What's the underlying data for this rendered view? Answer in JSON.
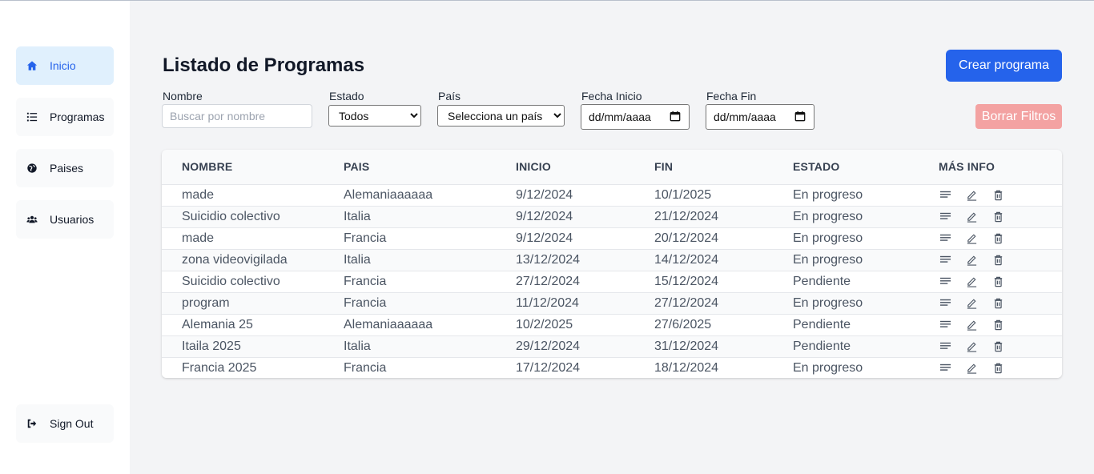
{
  "sidebar": {
    "items": [
      {
        "label": "Inicio",
        "icon": "home-icon",
        "active": true
      },
      {
        "label": "Programas",
        "icon": "list-icon",
        "active": false
      },
      {
        "label": "Paises",
        "icon": "globe-icon",
        "active": false
      },
      {
        "label": "Usuarios",
        "icon": "users-icon",
        "active": false
      }
    ],
    "signout_label": "Sign Out"
  },
  "header": {
    "title": "Listado de Programas",
    "create_label": "Crear programa",
    "clear_label": "Borrar Filtros"
  },
  "filters": {
    "nombre_label": "Nombre",
    "nombre_placeholder": "Buscar por nombre",
    "estado_label": "Estado",
    "estado_value": "Todos",
    "pais_label": "País",
    "pais_value": "Selecciona un país",
    "fecha_inicio_label": "Fecha Inicio",
    "fecha_inicio_value": "dd/mm/aaaa",
    "fecha_fin_label": "Fecha Fin",
    "fecha_fin_value": "dd/mm/aaaa"
  },
  "table": {
    "columns": [
      "NOMBRE",
      "PAIS",
      "INICIO",
      "FIN",
      "ESTADO",
      "MÁS INFO"
    ],
    "rows": [
      {
        "nombre": "made",
        "pais": "Alemaniaaaaaa",
        "inicio": "9/12/2024",
        "fin": "10/1/2025",
        "estado": "En progreso"
      },
      {
        "nombre": "Suicidio colectivo",
        "pais": "Italia",
        "inicio": "9/12/2024",
        "fin": "21/12/2024",
        "estado": "En progreso"
      },
      {
        "nombre": "made",
        "pais": "Francia",
        "inicio": "9/12/2024",
        "fin": "20/12/2024",
        "estado": "En progreso"
      },
      {
        "nombre": "zona videovigilada",
        "pais": "Italia",
        "inicio": "13/12/2024",
        "fin": "14/12/2024",
        "estado": "En progreso"
      },
      {
        "nombre": "Suicidio colectivo",
        "pais": "Francia",
        "inicio": "27/12/2024",
        "fin": "15/12/2024",
        "estado": "Pendiente"
      },
      {
        "nombre": "program",
        "pais": "Francia",
        "inicio": "11/12/2024",
        "fin": "27/12/2024",
        "estado": "En progreso"
      },
      {
        "nombre": "Alemania 25",
        "pais": "Alemaniaaaaaa",
        "inicio": "10/2/2025",
        "fin": "27/6/2025",
        "estado": "Pendiente"
      },
      {
        "nombre": "Itaila 2025",
        "pais": "Italia",
        "inicio": "29/12/2024",
        "fin": "31/12/2024",
        "estado": "Pendiente"
      },
      {
        "nombre": "Francia 2025",
        "pais": "Francia",
        "inicio": "17/12/2024",
        "fin": "18/12/2024",
        "estado": "En progreso"
      }
    ],
    "row_actions": [
      "details-icon",
      "edit-icon",
      "trash-icon"
    ]
  },
  "colors": {
    "primary": "#2563eb",
    "danger_disabled": "#f3a2a2",
    "active_nav_bg": "#e0f0fd",
    "background": "#f3f4f6"
  }
}
